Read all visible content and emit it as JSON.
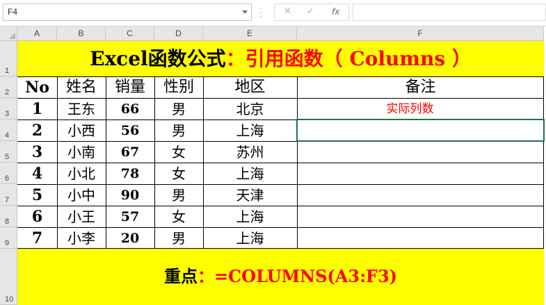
{
  "formula_bar": {
    "name_box": "F4",
    "cancel_icon": "close-icon",
    "enter_icon": "check-icon",
    "fx_label": "fx",
    "formula_value": ""
  },
  "columns": [
    "A",
    "B",
    "C",
    "D",
    "E",
    "F"
  ],
  "rows": [
    "1",
    "2",
    "3",
    "4",
    "5",
    "6",
    "7",
    "8",
    "9",
    "10"
  ],
  "title": {
    "part1": "Excel函数公式",
    "part2": "：引用函数（ Columns ）"
  },
  "table": {
    "headers": [
      "No",
      "姓名",
      "销量",
      "性别",
      "地区",
      "备注"
    ],
    "rows": [
      [
        "1",
        "王东",
        "66",
        "男",
        "北京",
        "实际列数"
      ],
      [
        "2",
        "小西",
        "56",
        "男",
        "上海",
        ""
      ],
      [
        "3",
        "小南",
        "67",
        "女",
        "苏州",
        ""
      ],
      [
        "4",
        "小北",
        "78",
        "女",
        "上海",
        ""
      ],
      [
        "5",
        "小中",
        "90",
        "男",
        "天津",
        ""
      ],
      [
        "6",
        "小王",
        "57",
        "女",
        "上海",
        ""
      ],
      [
        "7",
        "小李",
        "20",
        "男",
        "上海",
        ""
      ]
    ]
  },
  "footer": {
    "label": "重点",
    "formula": "：=COLUMNS(A3:F3)"
  },
  "colors": {
    "highlight": "#ffff00",
    "accent_red": "#ff0000",
    "selection": "#217346"
  }
}
